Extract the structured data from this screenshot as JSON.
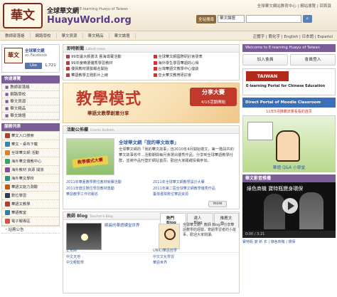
{
  "header": {
    "logo_mark": "華文",
    "site_cn": "全球華文網",
    "site_en": "E-learning Huayu of Taiwan",
    "site_url": "HuayuWorld.org",
    "top_links": "全球華文網站教育中心 | 網站導覽 | 回首頁",
    "search_label": "全站搜尋",
    "search_select": "華文論壇",
    "search_value": ""
  },
  "nav": {
    "items": [
      "教師部落格",
      "網路學校",
      "華文資源",
      "華文精品",
      "華文論壇"
    ],
    "right": "正體字 | 簡化字 | English | 日本語 | Español"
  },
  "facebook": {
    "name": "全球華文網",
    "on": "on Facebook",
    "like": "Like",
    "count": "1,721"
  },
  "quick_links": {
    "title": "快速導覽",
    "items": [
      "教師部落格",
      "網路學校",
      "華文資源",
      "華文精品",
      "華文論壇"
    ]
  },
  "services": {
    "title": "服務列表",
    "items": [
      {
        "label": "華文入口搜索",
        "color": "#c0392b"
      },
      {
        "label": "華文・桌布下載",
        "color": "#2e86c1"
      },
      {
        "label": "全球華文網 活動",
        "color": "#e67e22"
      },
      {
        "label": "海外華文僑教中心",
        "color": "#27ae60"
      },
      {
        "label": "海外教材 資源 開放",
        "color": "#8e44ad"
      },
      {
        "label": "海外華文學校",
        "color": "#16a085"
      },
      {
        "label": "華語文能力測驗",
        "color": "#d35400"
      },
      {
        "label": "數位學習",
        "color": "#2c3e50"
      },
      {
        "label": "華語文教學",
        "color": "#c0392b"
      },
      {
        "label": "華語教室",
        "color": "#2980b9"
      },
      {
        "label": "電子報專區",
        "color": "#e74c3c"
      }
    ],
    "footer": "・站務公告"
  },
  "news": {
    "title": "即時新聞",
    "title_en": "Latest news",
    "items": [
      "99年讓大師書法 藝海尋寶活動",
      "全球華文網國際研討會發表",
      "99年度精選優秀學習教材",
      "海外學生學習華語的心得",
      "優質教材選拔報名開始",
      "台灣華語文教學中心座談",
      "華語教學主題影片上線",
      "亞太華文教育研討會"
    ]
  },
  "banner": {
    "title": "教學模式",
    "subtitle": "華語文教學創意分享",
    "box_title": "分享大賽",
    "box_date": "4/15活動開始"
  },
  "events": {
    "title": "活動公佈欄",
    "title_en": "Events Bulletin",
    "image_sign": "教學模式大賽",
    "head": "全球華文網「我的華文故事」",
    "text": "全球華文網的「我的華文故事」自2010年4月開始徵文，第一階段共的華文故事收件…活動期間每月會選出優秀作品，分享到全球華語教學社群，並將作品刊登於網站首頁，歡迎大家踴躍投稿參加。",
    "links": [
      "2011年華夏教學數位教材競賽活動",
      "2011年全球華文網教學設計大賽",
      "2011年僑生數位學習教材獎勵",
      "2011年第二屆全球華文網教學優秀作品",
      "華語教學工作坊報名",
      "臺灣書院數位華語資源"
    ],
    "more": "more"
  },
  "blog": {
    "title": "教師 Blog",
    "title_en": "Teacher's Blog",
    "tabs": [
      "熱門Blog",
      "達人Blog",
      "推薦文章"
    ],
    "post_title": "曉晨的華語課堂世界",
    "post_text": "全球華文網 ‧ 教師 Blog：分享華語教學的經驗，寫給學習者的小故事，歡迎大家閱讀。",
    "links": [
      "正老師",
      "UNICI華語自學",
      "中文天地",
      "中文文化學習",
      "中文輕鬆學",
      "華語世界"
    ]
  },
  "right": {
    "welcome": "Welcome to E-learning Huayu of Taiwan",
    "join": "加入會員",
    "login": "會員登入",
    "ta_title": "TAIWAN ACADEMY",
    "ta_sub": "E-learning Portal for Chinese Education",
    "moodle": "Direct Portal of Moodle Classroom",
    "moodle_sub": "11年5月推薦流量看看的首頁",
    "promo_caption": "華語 Q&A 小學堂",
    "video_head": "華文影音推播",
    "video_caption": "綠色商機 寶特瓶變身環保",
    "video_bar": "0:00 / 3:21",
    "video_link": "寶特瓶 變 新 衣 | 綠色商機 | 環保"
  }
}
